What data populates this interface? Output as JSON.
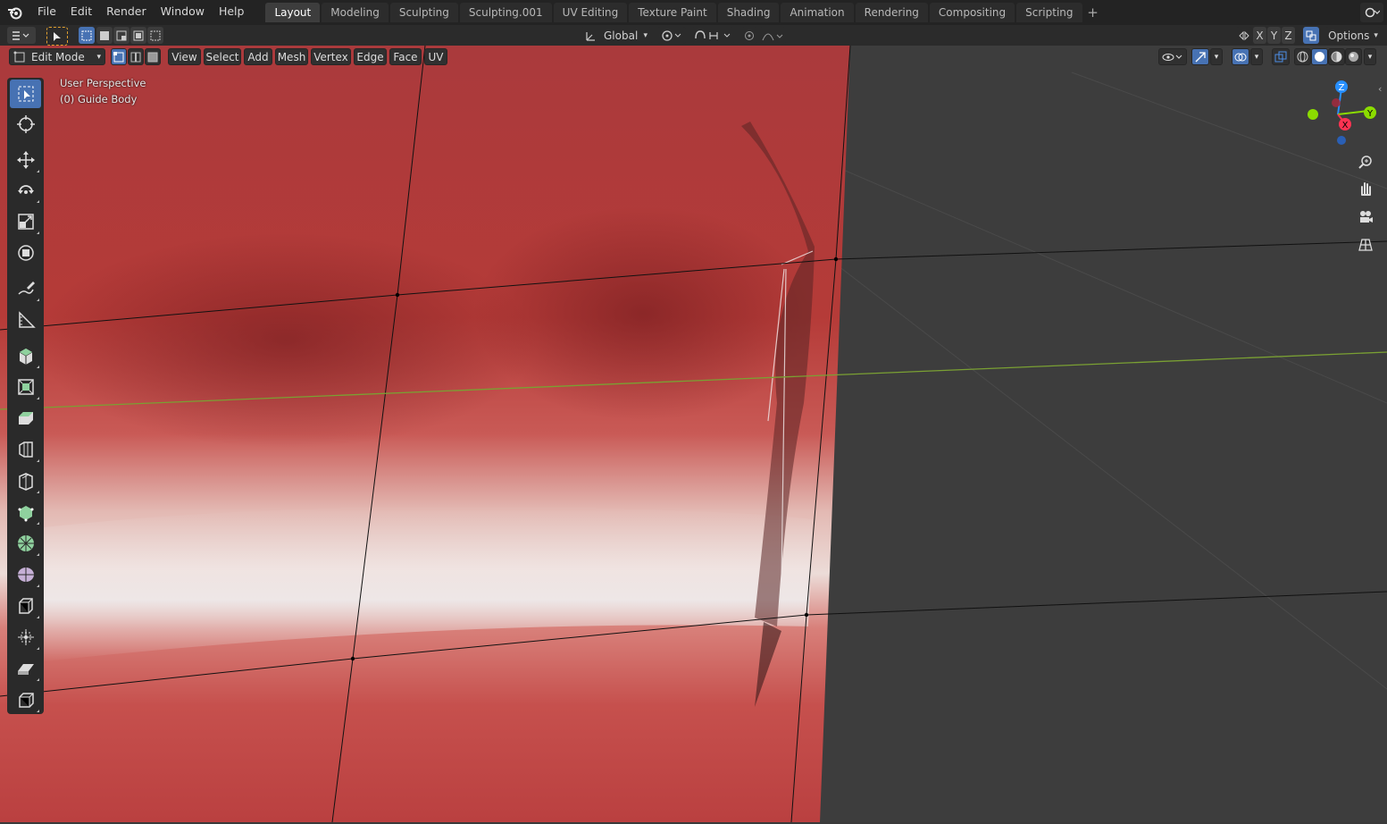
{
  "menus": [
    "File",
    "Edit",
    "Render",
    "Window",
    "Help"
  ],
  "workspaces": [
    "Layout",
    "Modeling",
    "Sculpting",
    "Sculpting.001",
    "UV Editing",
    "Texture Paint",
    "Shading",
    "Animation",
    "Rendering",
    "Compositing",
    "Scripting"
  ],
  "active_workspace": "Layout",
  "header": {
    "orientation": "Global",
    "axis_x": "X",
    "axis_y": "Y",
    "axis_z": "Z",
    "options": "Options"
  },
  "viewport_header": {
    "mode": "Edit Mode",
    "menus": [
      "View",
      "Select",
      "Add",
      "Mesh",
      "Vertex",
      "Edge",
      "Face",
      "UV"
    ]
  },
  "overlay": {
    "perspective": "User Perspective",
    "object": "(0) Guide Body"
  },
  "gizmo": {
    "z": "Z",
    "y": "Y",
    "x": "X"
  },
  "colors": {
    "accent": "#4772b3",
    "mesh_red": "#b83b3b",
    "viewport_bg": "#3d3d3d",
    "axis_x": "#ff3352",
    "axis_y": "#8bdc00",
    "axis_z": "#2890ff"
  }
}
